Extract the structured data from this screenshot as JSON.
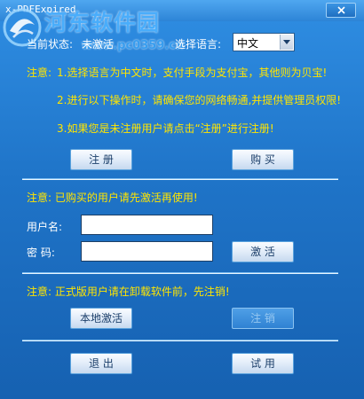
{
  "window": {
    "title": "x-PDFExpired"
  },
  "watermark": {
    "site_name": "河东软件园",
    "url": "www.pc0359.cn"
  },
  "status": {
    "label": "当前状态:",
    "value": "未激活"
  },
  "language": {
    "label": "选择语言:",
    "selected": "中文"
  },
  "notes": {
    "prefix": "注意:",
    "line1": "1.选择语言为中文时，支付手段为支付宝，其他则为贝宝!",
    "line2": "2.进行以下操作时，请确保您的网络畅通,并提供管理员权限!",
    "line3": "3.如果您是未注册用户请点击“注册”进行注册!"
  },
  "buttons": {
    "register": "注  册",
    "buy": "购  买",
    "activate": "激  活",
    "local_activate": "本地激活",
    "deregister": "注  销",
    "exit": "退  出",
    "trial": "试  用"
  },
  "activation": {
    "note": "注意: 已购买的用户请先激活再使用!",
    "username_label": "用户名:",
    "password_label": "密  码:",
    "username_value": "",
    "password_value": ""
  },
  "uninstall_note": "注意: 正式版用户请在卸载软件前，先注销!",
  "colors": {
    "note_text": "#ffe500",
    "label_text": "#ffffff",
    "background": "#1f74c8"
  }
}
